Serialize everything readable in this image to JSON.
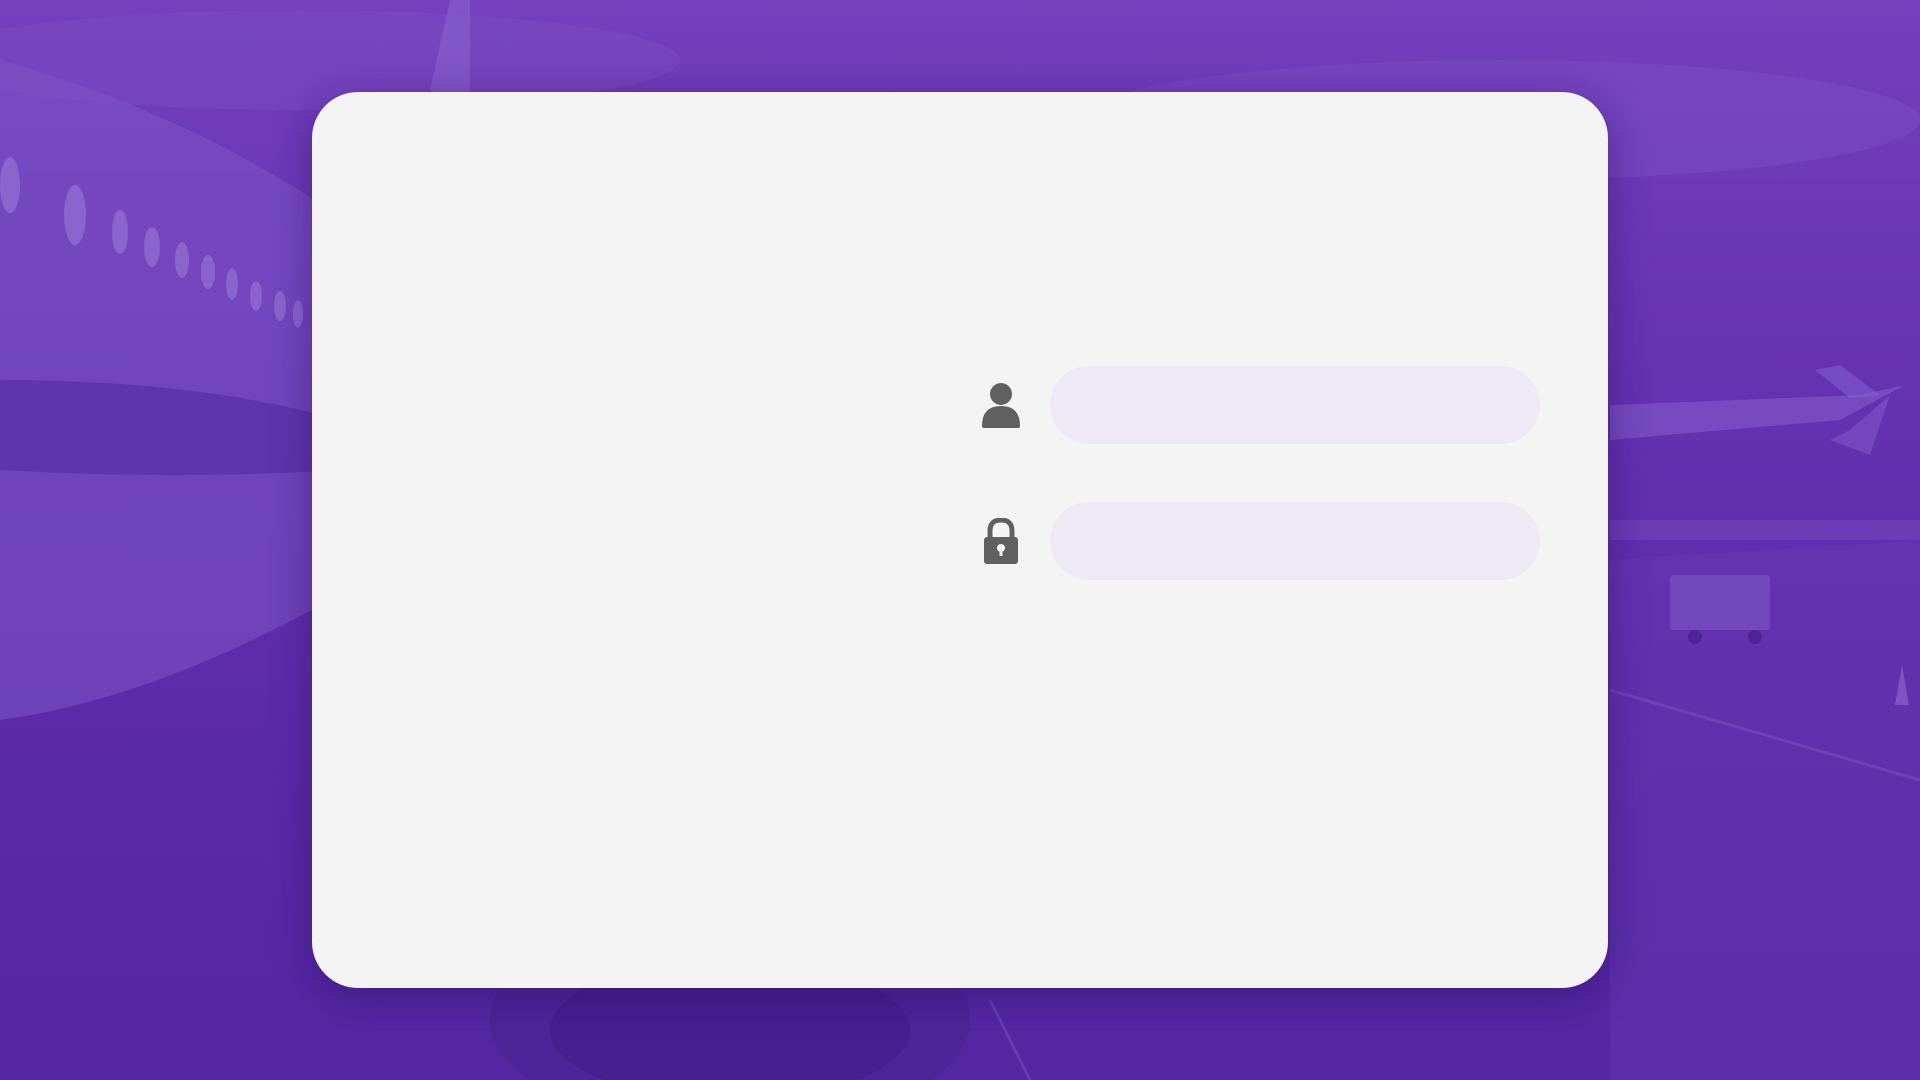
{
  "login": {
    "username": {
      "icon": "user-icon",
      "value": "",
      "placeholder": ""
    },
    "password": {
      "icon": "lock-icon",
      "value": "",
      "placeholder": ""
    }
  },
  "colors": {
    "background_overlay": "#6532b2",
    "card": "#f4f4f4",
    "input_fill": "#efe9f6",
    "icon": "#606060"
  }
}
